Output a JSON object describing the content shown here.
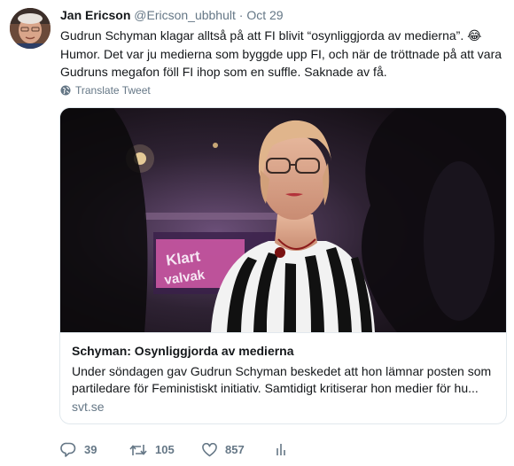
{
  "tweet": {
    "author_name": "Jan Ericson",
    "author_handle": "@Ericson_ubbhult",
    "separator": "·",
    "date": "Oct 29",
    "text_line1": "Gudrun Schyman klagar alltså på att FI blivit “osynliggjorda av medierna”.",
    "emoji": "😂",
    "text_line2": "Humor. Det var ju medierna som byggde upp FI, och när de tröttnade på att vara",
    "text_line3": "Gudruns megafon föll FI ihop som en suffle. Saknade av få.",
    "translate_label": "Translate Tweet"
  },
  "card": {
    "image_sign_text_1": "Klart",
    "image_sign_text_2": "valvak",
    "title": "Schyman: Osynliggjorda av medierna",
    "description_line1": "Under söndagen gav Gudrun Schyman beskedet att hon lämnar posten som",
    "description_line2": "partiledare för Feministiskt initiativ. Samtidigt kritiserar hon medier för hu...",
    "domain": "svt.se"
  },
  "actions": {
    "replies": "39",
    "retweets": "105",
    "likes": "857"
  },
  "icons": [
    "globe-icon",
    "reply-icon",
    "retweet-icon",
    "like-icon",
    "analytics-icon"
  ],
  "colors": {
    "secondary_text": "#657786",
    "primary_text": "#14171a",
    "card_border": "#e1e8ed"
  }
}
